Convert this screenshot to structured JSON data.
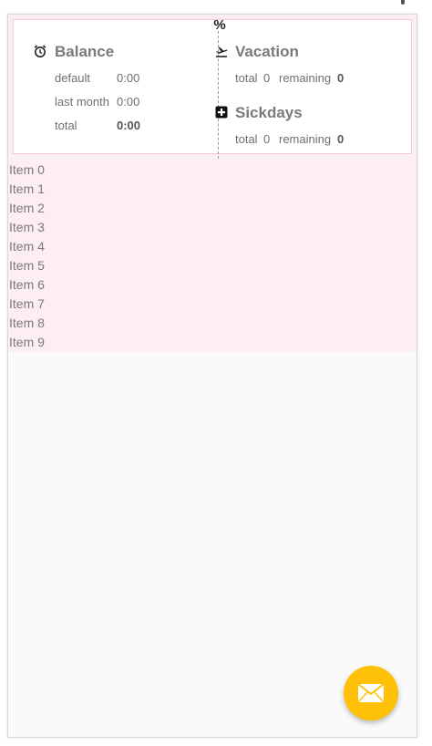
{
  "balance": {
    "title": "Balance",
    "rows": [
      {
        "label": "default",
        "value": "0:00"
      },
      {
        "label": "last month",
        "value": "0:00"
      },
      {
        "label": "total",
        "value": "0:00"
      }
    ]
  },
  "vacation": {
    "title": "Vacation",
    "total_label": "total",
    "total_value": "0",
    "remaining_label": "remaining",
    "remaining_value": "0"
  },
  "sickdays": {
    "title": "Sickdays",
    "total_label": "total",
    "total_value": "0",
    "remaining_label": "remaining",
    "remaining_value": "0"
  },
  "divider_icon": "%",
  "list": {
    "items": [
      "Item 0",
      "Item 1",
      "Item 2",
      "Item 3",
      "Item 4",
      "Item 5",
      "Item 6",
      "Item 7",
      "Item 8",
      "Item 9"
    ]
  },
  "icons": {
    "balance": "alarm-clock-icon",
    "vacation": "airplane-takeoff-icon",
    "sickdays": "medical-cross-icon",
    "fab": "mail-icon",
    "divider": "percent-icon"
  },
  "colors": {
    "accent_bg": "#fdeef1",
    "fab": "#ffc107",
    "card_border": "#f2c8d2"
  }
}
